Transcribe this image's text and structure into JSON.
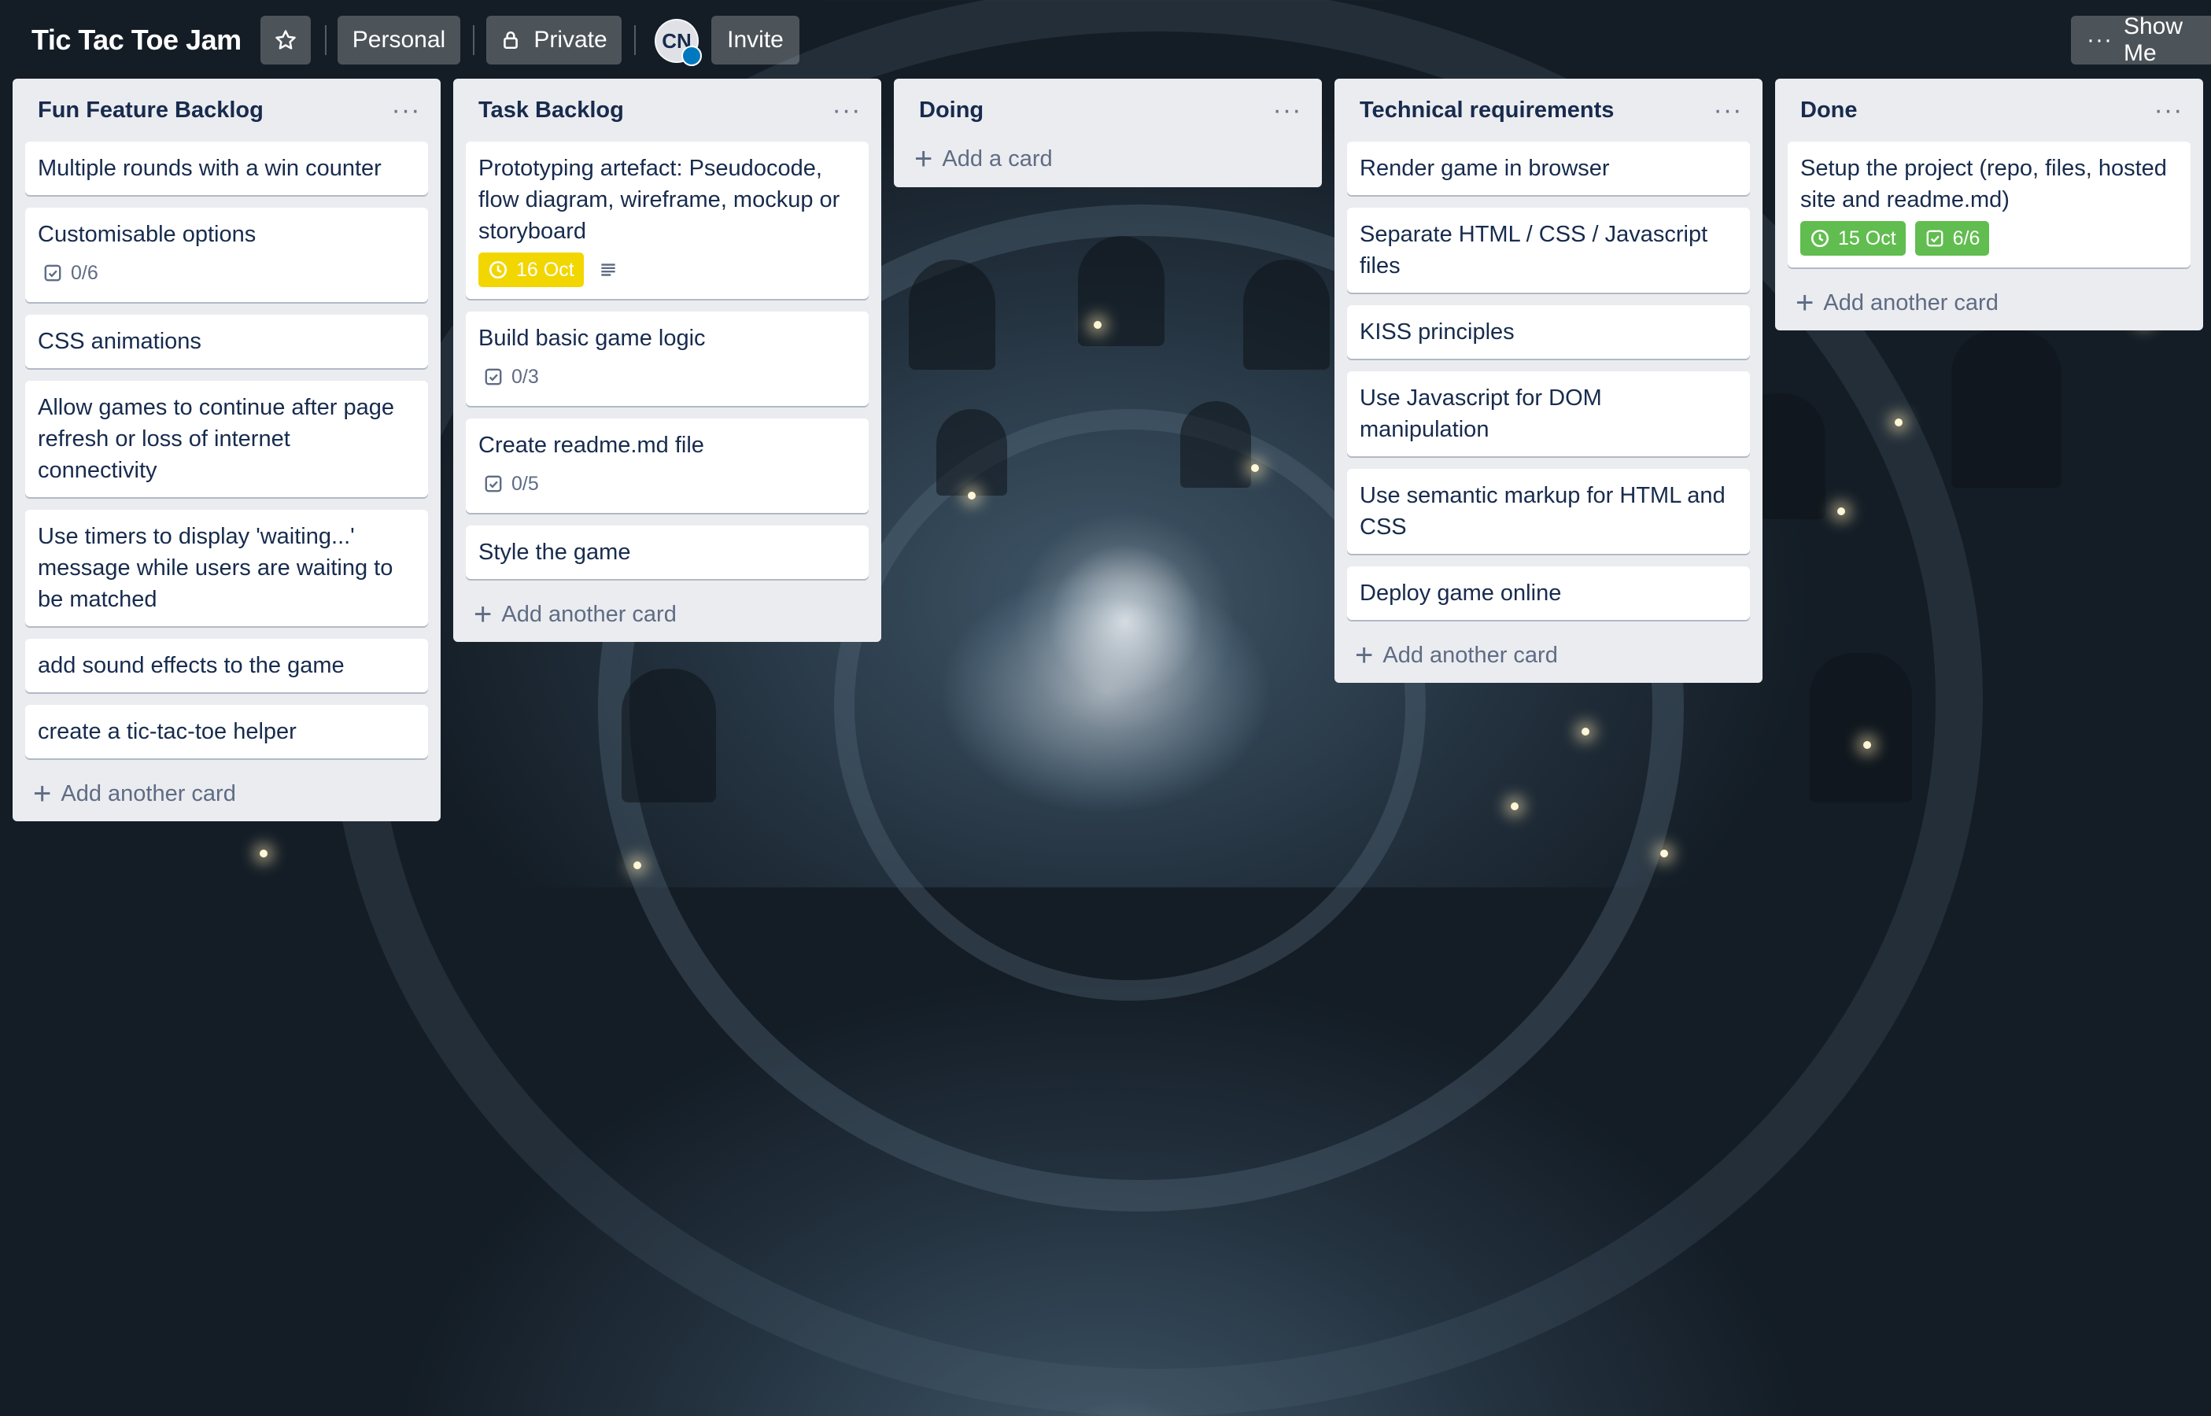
{
  "board": {
    "title": "Tic Tac Toe Jam",
    "personal_label": "Personal",
    "private_label": "Private",
    "avatar_initials": "CN",
    "invite_label": "Invite",
    "show_menu_label": "Show Me",
    "accent_colors": {
      "due_yellow": "#f2d600",
      "done_green": "#61bd4f",
      "list_bg": "#ebecf0"
    }
  },
  "lists": [
    {
      "title": "Fun Feature Backlog",
      "cards": [
        {
          "title": "Multiple rounds with a win counter"
        },
        {
          "title": "Customisable options",
          "checklist": "0/6"
        },
        {
          "title": "CSS animations"
        },
        {
          "title": "Allow games to continue after page refresh or loss of internet connectivity"
        },
        {
          "title": "Use timers to display 'waiting...' message while users are waiting to be matched"
        },
        {
          "title": "add sound effects to the game"
        },
        {
          "title": "create a tic-tac-toe helper"
        }
      ],
      "add_label": "Add another card"
    },
    {
      "title": "Task Backlog",
      "cards": [
        {
          "title": "Prototyping artefact: Pseudocode, flow diagram, wireframe, mockup or storyboard",
          "due": "16 Oct",
          "has_description": true
        },
        {
          "title": "Build basic game logic",
          "checklist": "0/3"
        },
        {
          "title": "Create readme.md file",
          "checklist": "0/5"
        },
        {
          "title": "Style the game"
        }
      ],
      "add_label": "Add another card"
    },
    {
      "title": "Doing",
      "cards": [],
      "add_label": "Add a card"
    },
    {
      "title": "Technical requirements",
      "cards": [
        {
          "title": "Render game in browser"
        },
        {
          "title": "Separate HTML / CSS / Javascript files"
        },
        {
          "title": "KISS principles"
        },
        {
          "title": "Use Javascript for DOM manipulation"
        },
        {
          "title": "Use semantic markup for HTML and CSS"
        },
        {
          "title": "Deploy game online"
        }
      ],
      "add_label": "Add another card"
    },
    {
      "title": "Done",
      "cards": [
        {
          "title": "Setup the project (repo, files, hosted site and readme.md)",
          "due": "15 Oct",
          "checklist": "6/6",
          "complete": true
        }
      ],
      "add_label": "Add another card"
    }
  ]
}
